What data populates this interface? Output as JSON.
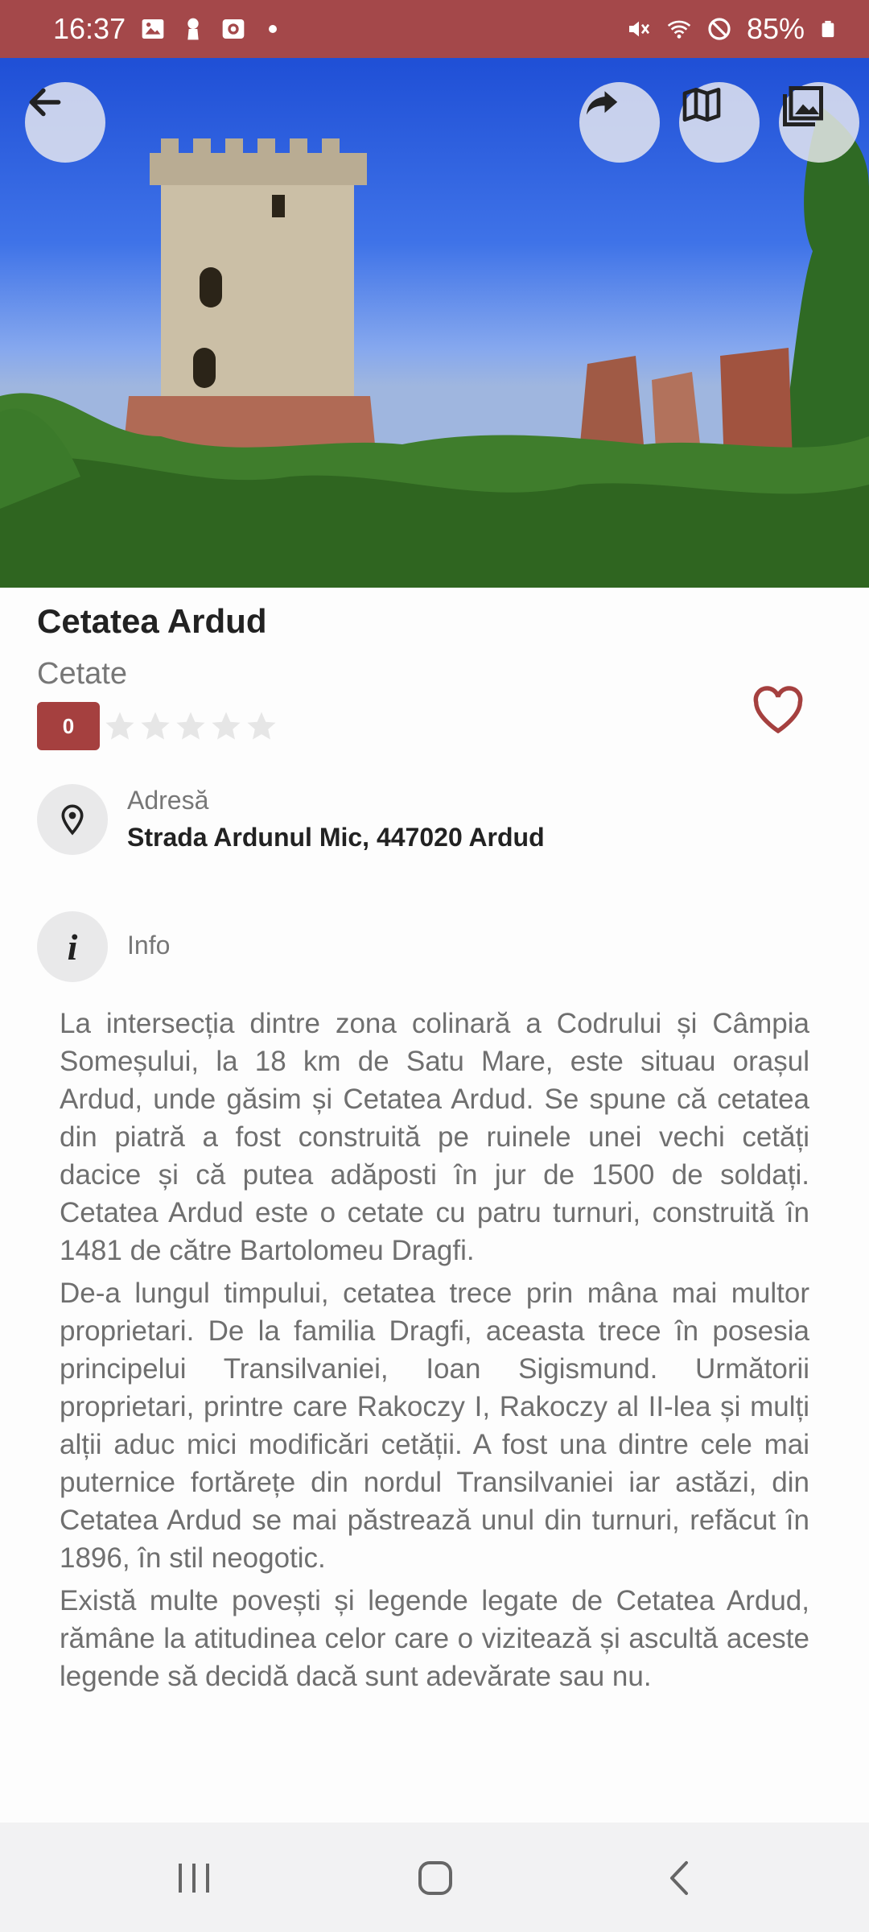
{
  "status_bar": {
    "time": "16:37",
    "battery": "85%",
    "icons_left": [
      "gallery-icon",
      "keyhole-icon",
      "camera-icon",
      "dot"
    ],
    "icons_right": [
      "mute-icon",
      "wifi-icon",
      "dnd-icon",
      "battery-icon"
    ],
    "color": "#a4484a"
  },
  "toolbar": {
    "back": "back-arrow-icon",
    "share": "share-icon",
    "map": "map-icon",
    "gallery": "gallery-icon"
  },
  "place": {
    "name": "Cetatea Ardud",
    "category": "Cetate",
    "rating": "0",
    "stars_filled": 0,
    "stars_total": 5
  },
  "address": {
    "label": "Adresă",
    "value": "Strada Ardunul Mic, 447020 Ardud"
  },
  "info": {
    "label": "Info",
    "paragraphs": [
      "La intersecția dintre zona colinară a Codrului și Câmpia Someșului, la 18 km de Satu Mare, este situau orașul Ardud, unde găsim și Cetatea Ardud. Se spune că cetatea din piatră a fost construită pe ruinele unei vechi cetăți dacice și că putea adăposti în jur de 1500 de soldați. Cetatea Ardud este o cetate cu patru turnuri, construită în 1481 de către Bartolomeu Dragfi.",
      "De-a lungul timpului, cetatea trece prin mâna mai multor proprietari. De la familia Dragfi, aceasta trece în posesia principelui Transilvaniei, Ioan Sigismund. Următorii proprietari, printre care Rakoczy I, Rakoczy al II-lea și mulți alții aduc mici modificări cetății. A fost una dintre cele mai puternice fortărețe din nordul Transilvaniei iar astăzi, din Cetatea Ardud se mai păstrează unul din turnuri, refăcut în 1896, în stil neogotic.",
      "Există multe povești și legende legate de Cetatea Ardud, rămâne la atitudinea celor care o vizitează și ascultă aceste legende să decidă dacă sunt adevărate sau nu."
    ]
  },
  "accent_color": "#a5403f",
  "nav": {
    "recents": "recents-icon",
    "home": "home-icon",
    "back": "back-icon"
  }
}
